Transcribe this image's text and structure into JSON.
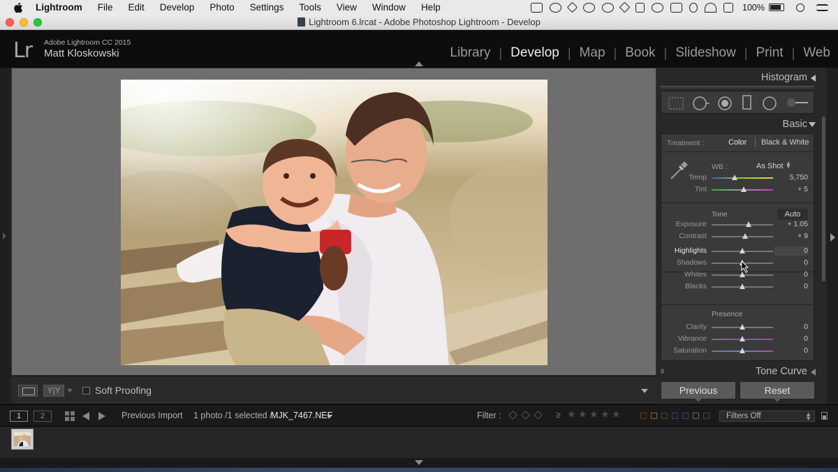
{
  "menubar": {
    "items": [
      "Lightroom",
      "File",
      "Edit",
      "Develop",
      "Photo",
      "Settings",
      "Tools",
      "View",
      "Window",
      "Help"
    ],
    "battery": "100%"
  },
  "window": {
    "title": "Lightroom 6.lrcat - Adobe Photoshop Lightroom - Develop"
  },
  "identity": {
    "logo": "Lr",
    "product": "Adobe Lightroom CC 2015",
    "user": "Matt Kloskowski"
  },
  "modules": [
    "Library",
    "Develop",
    "Map",
    "Book",
    "Slideshow",
    "Print",
    "Web"
  ],
  "toolbar": {
    "yy_label": "Y|Y",
    "soft_proofing": "Soft Proofing"
  },
  "panel": {
    "histogram": "Histogram",
    "basic": "Basic",
    "treatment_label": "Treatment :",
    "treatment_color": "Color",
    "treatment_bw": "Black & White",
    "wb_label": "WB :",
    "wb_value": "As Shot",
    "wb_sliders": [
      {
        "label": "Temp",
        "value": "5,750",
        "pos": 0.38
      },
      {
        "label": "Tint",
        "value": "+ 5",
        "pos": 0.52
      }
    ],
    "tone_label": "Tone",
    "auto": "Auto",
    "tone_sliders_a": [
      {
        "label": "Exposure",
        "value": "+ 1.05",
        "pos": 0.6
      },
      {
        "label": "Contrast",
        "value": "+ 9",
        "pos": 0.54
      }
    ],
    "tone_sliders_b": [
      {
        "label": "Highlights",
        "value": "0",
        "pos": 0.5
      },
      {
        "label": "Shadows",
        "value": "0",
        "pos": 0.5
      },
      {
        "label": "Whites",
        "value": "0",
        "pos": 0.5
      },
      {
        "label": "Blacks",
        "value": "0",
        "pos": 0.5
      }
    ],
    "presence_label": "Presence",
    "presence_sliders": [
      {
        "label": "Clarity",
        "value": "0",
        "pos": 0.5
      },
      {
        "label": "Vibrance",
        "value": "0",
        "pos": 0.5
      },
      {
        "label": "Saturation",
        "value": "0",
        "pos": 0.5
      }
    ],
    "tone_curve": "Tone Curve",
    "previous": "Previous",
    "reset": "Reset"
  },
  "filmbar": {
    "view1": "1",
    "view2": "2",
    "source": "Previous Import",
    "count": "1 photo /1 selected /",
    "file": "MJK_7467.NEF",
    "filter_label": "Filter :",
    "ge": "≥",
    "filters_off": "Filters Off"
  },
  "colors": {
    "accent_label_red": "#c0392b",
    "accent_label_yellow": "#c9b230",
    "accent_label_green": "#3e8e3e",
    "accent_label_blue": "#3a6fb5",
    "accent_label_purple": "#8a4fb0"
  }
}
